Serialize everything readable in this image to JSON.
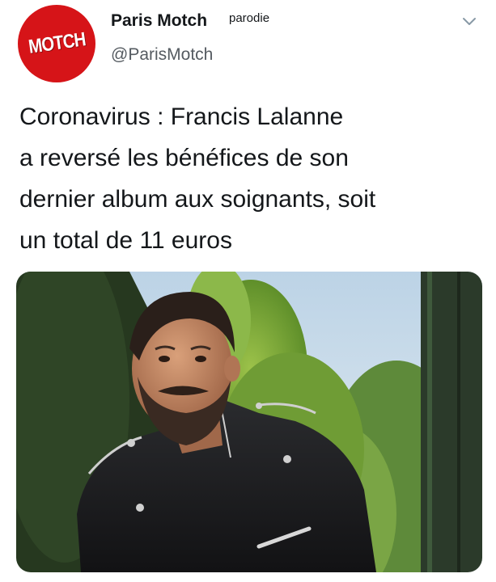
{
  "account": {
    "avatar_text": "MOTCH",
    "display_name": "Paris Motch",
    "parody_label": "parodie",
    "handle": "@ParisMotch"
  },
  "icons": {
    "menu": "chevron-down-icon"
  },
  "tweet": {
    "lines": [
      "Coronavirus : Francis Lalanne",
      "a reversé les bénéfices de son",
      "dernier album aux soignants, soit",
      "un total de 11 euros"
    ]
  },
  "colors": {
    "avatar_red": "#d61418",
    "text": "#14171a",
    "secondary_text": "#555b61"
  }
}
